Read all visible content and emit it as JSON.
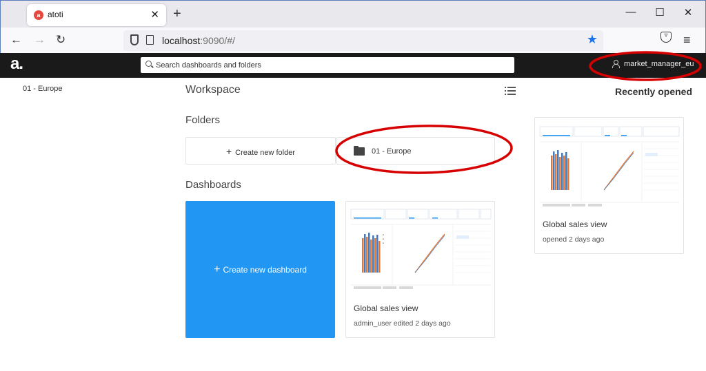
{
  "browser": {
    "tab_title": "atoti",
    "tab_favicon": "a",
    "tab_close": "✕",
    "new_tab": "+",
    "window": {
      "minimize": "—",
      "maximize": "☐",
      "close": "✕"
    },
    "url_host": "localhost",
    "url_rest": ":9090/#/",
    "nav": {
      "back": "←",
      "forward": "→",
      "reload": "↻",
      "star": "★",
      "pocket": "▿",
      "menu": "≡"
    }
  },
  "app": {
    "logo": "a.",
    "search_placeholder": "Search dashboards and folders",
    "user": "market_manager_eu"
  },
  "sidebar": {
    "items": [
      {
        "label": "01 - Europe"
      }
    ]
  },
  "workspace": {
    "title": "Workspace",
    "folders_title": "Folders",
    "create_folder": "Create new folder",
    "folders": [
      {
        "name": "01 - Europe"
      }
    ],
    "dashboards_title": "Dashboards",
    "create_dashboard": "Create new dashboard",
    "dashboards": [
      {
        "name": "Global sales view",
        "meta": "admin_user edited 2 days ago"
      }
    ]
  },
  "recent": {
    "title": "Recently opened",
    "items": [
      {
        "name": "Global sales view",
        "meta": "opened 2 days ago"
      }
    ]
  },
  "colors": {
    "accent": "#2196f3",
    "header_bg": "#1a1a1a",
    "annotation": "#d60000",
    "favicon": "#e8473d"
  }
}
